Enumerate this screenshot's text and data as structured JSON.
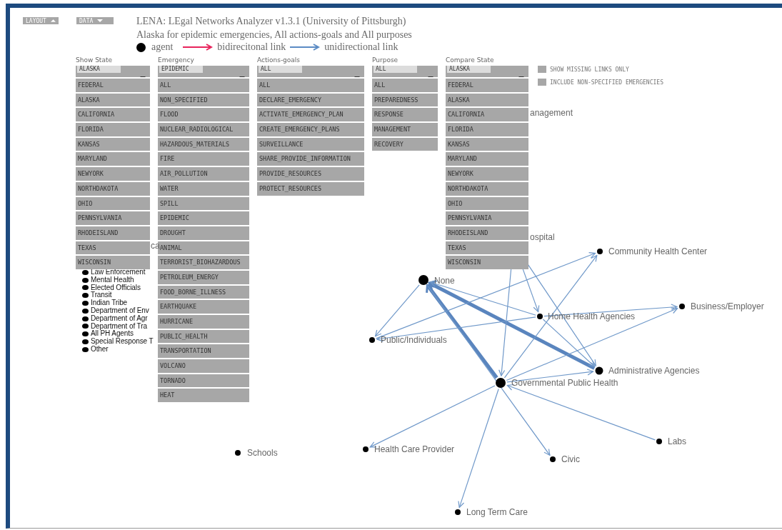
{
  "toolbar": {
    "buttons": [
      {
        "label": "LAYOUT"
      },
      {
        "label": "DATA"
      }
    ]
  },
  "header": {
    "title": "LENA: LEgal Networks Analyzer v1.3.1 (University of Pittsburgh)",
    "subtitle": "Alaska for epidemic emergencies, All actions-goals and All purposes",
    "legend": [
      {
        "kind": "agent",
        "label": "agent"
      },
      {
        "kind": "link",
        "label": "bidirecitonal link",
        "color": "#e8245c"
      },
      {
        "kind": "link",
        "label": "unidirectional link",
        "color": "#5b8bc4"
      }
    ]
  },
  "filters": [
    {
      "label": "Show State",
      "value": "ALASKA",
      "expanded": true,
      "options": [
        "FEDERAL",
        "ALASKA",
        "CALIFORNIA",
        "FLORIDA",
        "KANSAS",
        "MARYLAND",
        "NEWYORK",
        "NORTHDAKOTA",
        "OHIO",
        "PENNSYLVANIA",
        "RHODEISLAND",
        "TEXAS",
        "WISCONSIN"
      ]
    },
    {
      "label": "Emergency",
      "value": "EPIDEMIC",
      "expanded": true,
      "options": [
        "ALL",
        "NON_SPECIFIED",
        "FLOOD",
        "NUCLEAR_RADIOLOGICAL",
        "HAZARDOUS_MATERIALS",
        "FIRE",
        "AIR_POLLUTION",
        "WATER",
        "SPILL",
        "EPIDEMIC",
        "DROUGHT",
        "ANIMAL",
        "TERRORIST_BIOHAZARDOUS",
        "PETROLEUM_ENERGY",
        "FOOD_BORNE_ILLNESS",
        "EARTHQUAKE",
        "HURRICANE",
        "PUBLIC_HEALTH",
        "TRANSPORTATION",
        "VOLCANO",
        "TORNADO",
        "HEAT"
      ]
    },
    {
      "label": "Actions-goals",
      "value": "ALL",
      "expanded": true,
      "options": [
        "ALL",
        "DECLARE_EMERGENCY",
        "ACTIVATE_EMERGENCY_PLAN",
        "CREATE_EMERGENCY_PLANS",
        "SURVEILLANCE",
        "SHARE_PROVIDE_INFORMATION",
        "PROVIDE_RESOURCES",
        "PROTECT_RESOURCES"
      ]
    },
    {
      "label": "Purpose",
      "value": "ALL",
      "expanded": true,
      "options": [
        "ALL",
        "PREPAREDNESS",
        "RESPONSE",
        "MANAGEMENT",
        "RECOVERY"
      ]
    },
    {
      "label": "Compare State",
      "value": "ALASKA",
      "expanded": true,
      "options": [
        "FEDERAL",
        "ALASKA",
        "CALIFORNIA",
        "FLORIDA",
        "KANSAS",
        "MARYLAND",
        "NEWYORK",
        "NORTHDAKOTA",
        "OHIO",
        "PENNSYLVANIA",
        "RHODEISLAND",
        "TEXAS",
        "WISCONSIN"
      ]
    }
  ],
  "checkboxes": [
    {
      "label": "SHOW MISSING LINKS ONLY",
      "checked": false
    },
    {
      "label": "INCLUDE NON-SPECIFIED EMERGENCIES",
      "checked": false
    }
  ],
  "agent_list": {
    "fragment": "ca",
    "items": [
      "Law Enforcement",
      "Mental Health",
      "Elected Officials",
      "Transit",
      "Indian Tribe",
      "Department of Env",
      "Department of Agr",
      "Department of Tra",
      "All PH Agents",
      "Special Response T",
      "Other"
    ]
  },
  "network": {
    "partial_labels": [
      "anagement",
      "ospital"
    ],
    "nodes": [
      {
        "label": "Community Health Center"
      },
      {
        "label": "None"
      },
      {
        "label": "Business/Employer"
      },
      {
        "label": "Home Health Agencies"
      },
      {
        "label": "Public/Individuals"
      },
      {
        "label": "Administrative Agencies"
      },
      {
        "label": "Governmental Public Health"
      },
      {
        "label": "Labs"
      },
      {
        "label": "Health Care Provider"
      },
      {
        "label": "Schools"
      },
      {
        "label": "Civic"
      },
      {
        "label": "Long Term Care"
      }
    ]
  }
}
